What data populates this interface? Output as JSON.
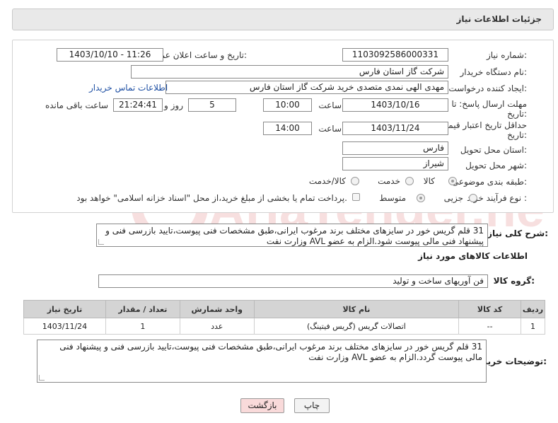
{
  "header": {
    "title": "جزئیات اطلاعات نیاز"
  },
  "form": {
    "need_number_label": "شماره نیاز:",
    "need_number": "1103092586000331",
    "announce_label": "تاریخ و ساعت اعلان عمومی:",
    "announce_value": "1403/10/10 - 11:26",
    "buyer_org_label": "نام دستگاه خریدار:",
    "buyer_org": "شرکت گاز استان فارس",
    "requester_label": "ایجاد کننده درخواست:",
    "requester": "مهدی الهی نمدی متصدی خرید شرکت گاز استان فارس",
    "buyer_contact_link": "اطلاعات تماس خریدار",
    "deadline_label_1": "مهلت ارسال پاسخ: تا",
    "deadline_label_2": "تاریخ:",
    "deadline_date": "1403/10/16",
    "time_label": "ساعت",
    "deadline_time": "10:00",
    "days_value": "5",
    "days_label": "روز و",
    "remaining_time": "21:24:41",
    "remaining_label": "ساعت باقی مانده",
    "validity_label_1": "حداقل تاریخ اعتبار قیمت: تا",
    "validity_label_2": "تاریخ:",
    "validity_date": "1403/11/24",
    "validity_time": "14:00",
    "province_label": "استان محل تحویل:",
    "province": "فارس",
    "city_label": "شهر محل تحویل:",
    "city": "شیراز",
    "category_label": "طبقه بندی موضوعی:",
    "category_options": [
      "کالا",
      "خدمت",
      "کالا/خدمت"
    ],
    "process_label": "نوع فرآیند خرید :",
    "process_options": [
      "جزیی",
      "متوسط"
    ],
    "payment_note": "پرداخت تمام یا بخشی از مبلغ خرید،از محل \"اسناد خزانه اسلامی\" خواهد بود."
  },
  "summary": {
    "label": "شرح کلی نیاز:",
    "text": "31 قلم گریس خور در سایزهای مختلف برند مرغوب ایرانی،طبق مشخصات فنی پیوست،تایید بازرسی فنی و پیشنهاد فنی مالی پیوست شود.الزام به عضو AVL وزارت نفت"
  },
  "goods": {
    "section_title": "اطلاعات کالاهای مورد نیاز",
    "group_label": "گروه کالا:",
    "group_value": "فن آوریهای ساخت و تولید",
    "columns": [
      "ردیف",
      "کد کالا",
      "نام کالا",
      "واحد شمارش",
      "تعداد / مقدار",
      "تاریخ نیاز"
    ],
    "rows": [
      [
        "1",
        "--",
        "اتصالات گریس (گریس فیتینگ)",
        "عدد",
        "1",
        "1403/11/24"
      ]
    ]
  },
  "buyer_notes": {
    "label": "توضیحات خریدار:",
    "text": "31 قلم گریس خور در سایزهای مختلف برند مرغوب ایرانی،طبق مشخصات فنی پیوست،تایید بازرسی فنی و پیشنهاد فنی مالی پیوست گردد.الزام به عضو AVL وزارت نفت"
  },
  "buttons": {
    "print": "چاپ",
    "back": "بازگشت"
  },
  "watermark": "AriaTender.neT",
  "colors": {
    "link": "#1e4fa3",
    "header_bg": "#e9e9e9",
    "back_bg": "#f9dada"
  }
}
